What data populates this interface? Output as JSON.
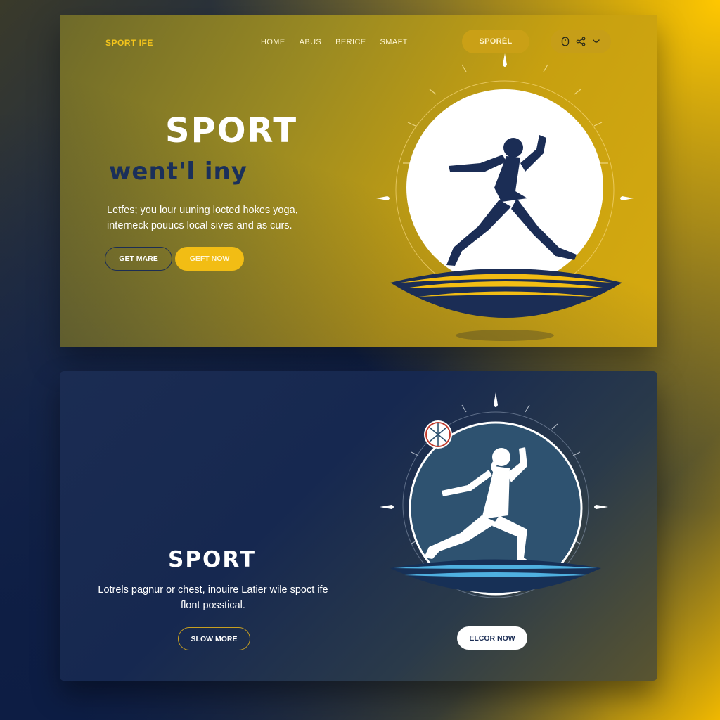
{
  "header": {
    "logo": "SPORT IFE",
    "nav": [
      "HOME",
      "ABUS",
      "BERICE",
      "SMAFT"
    ],
    "cta": "SPORÉL",
    "icons": [
      "mouse-icon",
      "share-icon",
      "heart-icon"
    ]
  },
  "hero": {
    "title": "SPORT",
    "subtitle": "went'l iny",
    "description": "Letfes; you lour uuning locted hokes yoga, interneck pouucs local sives and as curs.",
    "buttons": {
      "secondary": "GET MARE",
      "primary": "GEFT NOW"
    }
  },
  "section2": {
    "title": "SPORT",
    "description": "Lotrels pagnur or chest, inouire Latier wile spoct ife flont posstical.",
    "buttons": {
      "secondary": "SLOW MORE",
      "primary": "ELCOR NOW"
    }
  },
  "colors": {
    "accent": "#f2bd14",
    "navy": "#1b2d55",
    "white": "#ffffff"
  }
}
